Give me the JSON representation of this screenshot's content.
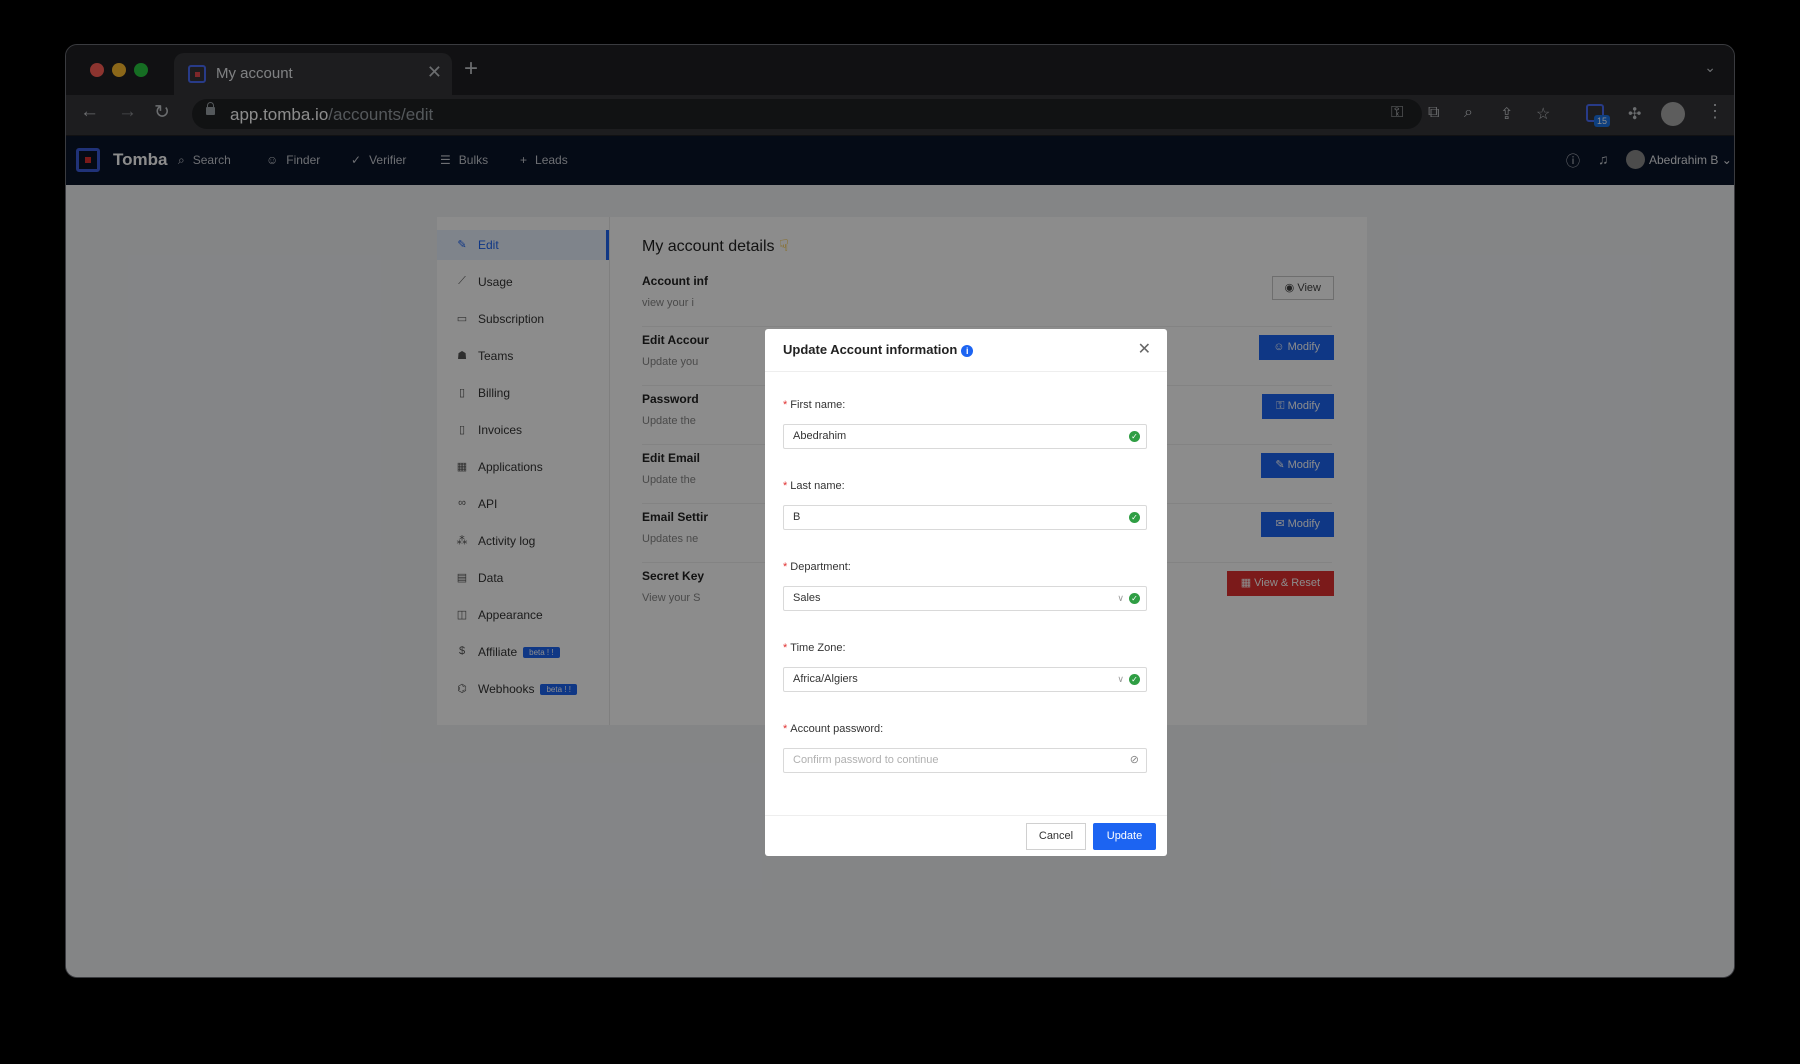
{
  "browser": {
    "tab_title": "My account",
    "url_host": "app.tomba.io",
    "url_path": "/accounts/edit",
    "extension_badge": "15"
  },
  "app": {
    "brand": "Tomba",
    "nav": [
      {
        "label": "Search",
        "icon": "search-icon"
      },
      {
        "label": "Finder",
        "icon": "user-icon"
      },
      {
        "label": "Verifier",
        "icon": "check-icon"
      },
      {
        "label": "Bulks",
        "icon": "list-icon"
      },
      {
        "label": "Leads",
        "icon": "plus-icon"
      }
    ],
    "user_name": "Abedrahim B"
  },
  "sidebar": {
    "items": [
      {
        "label": "Edit",
        "icon": "pencil-icon",
        "active": true
      },
      {
        "label": "Usage",
        "icon": "chart-icon"
      },
      {
        "label": "Subscription",
        "icon": "card-icon"
      },
      {
        "label": "Teams",
        "icon": "team-icon"
      },
      {
        "label": "Billing",
        "icon": "file-icon"
      },
      {
        "label": "Invoices",
        "icon": "invoice-icon"
      },
      {
        "label": "Applications",
        "icon": "apps-icon"
      },
      {
        "label": "API",
        "icon": "link-icon"
      },
      {
        "label": "Activity log",
        "icon": "activity-icon"
      },
      {
        "label": "Data",
        "icon": "data-icon"
      },
      {
        "label": "Appearance",
        "icon": "layout-icon"
      },
      {
        "label": "Affiliate",
        "icon": "money-icon",
        "badge": "beta ! !"
      },
      {
        "label": "Webhooks",
        "icon": "webhook-icon",
        "badge": "beta ! !"
      }
    ]
  },
  "main": {
    "title": "My account details",
    "rows": [
      {
        "title": "Account inf",
        "desc": "view your i",
        "button": "View"
      },
      {
        "title": "Edit Accour",
        "desc": "Update you",
        "button": "Modify"
      },
      {
        "title": "Password",
        "desc": "Update the",
        "button": "Modify"
      },
      {
        "title": "Edit Email",
        "desc": "Update the",
        "button": "Modify"
      },
      {
        "title": "Email Settir",
        "desc": "Updates ne",
        "button": "Modify"
      },
      {
        "title": "Secret Key",
        "desc": "View your S",
        "button": "View & Reset"
      }
    ]
  },
  "modal": {
    "title": "Update Account information",
    "fields": {
      "first_name": {
        "label": "First name",
        "value": "Abedrahim"
      },
      "last_name": {
        "label": "Last name",
        "value": "B"
      },
      "department": {
        "label": "Department",
        "value": "Sales"
      },
      "time_zone": {
        "label": "Time Zone",
        "value": "Africa/Algiers"
      },
      "password": {
        "label": "Account password",
        "placeholder": "Confirm password to continue"
      }
    },
    "cancel_label": "Cancel",
    "update_label": "Update"
  },
  "colors": {
    "accent": "#1c64f2",
    "danger": "#e03131",
    "appbar": "#0a1429",
    "success": "#2f9e44"
  }
}
